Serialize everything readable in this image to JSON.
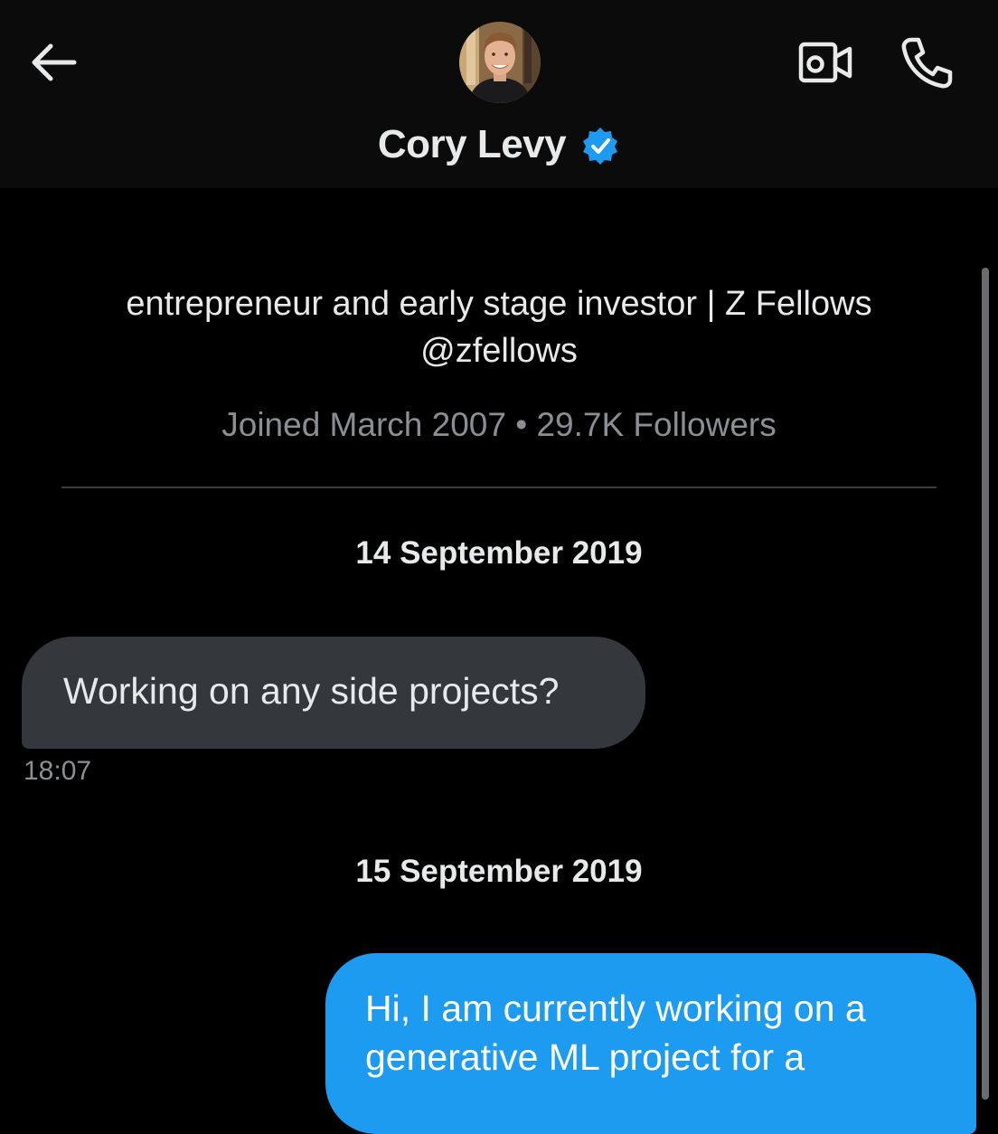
{
  "conversation": {
    "contact_name": "Cory Levy",
    "verified": true
  },
  "profile": {
    "bio_line1": "entrepreneur and early stage investor | Z Fellows",
    "bio_line2": "@zfellows",
    "meta": "Joined March 2007 • 29.7K Followers"
  },
  "messages": [
    {
      "date": "14 September 2019",
      "direction": "incoming",
      "text": "Working on any side projects?",
      "time": "18:07"
    },
    {
      "date": "15 September 2019",
      "direction": "outgoing",
      "text": "Hi, I am currently working on a generative ML project for a"
    }
  ],
  "icons": {
    "back": "arrow-left-icon",
    "video": "video-camera-icon",
    "call": "phone-icon",
    "verified": "verified-badge-icon"
  },
  "colors": {
    "background": "#000000",
    "header_background": "#0b0b0b",
    "incoming_bubble": "#34373b",
    "outgoing_bubble": "#1d9bf0",
    "verified_badge": "#1d9bf0",
    "secondary_text": "#8b8f94"
  }
}
